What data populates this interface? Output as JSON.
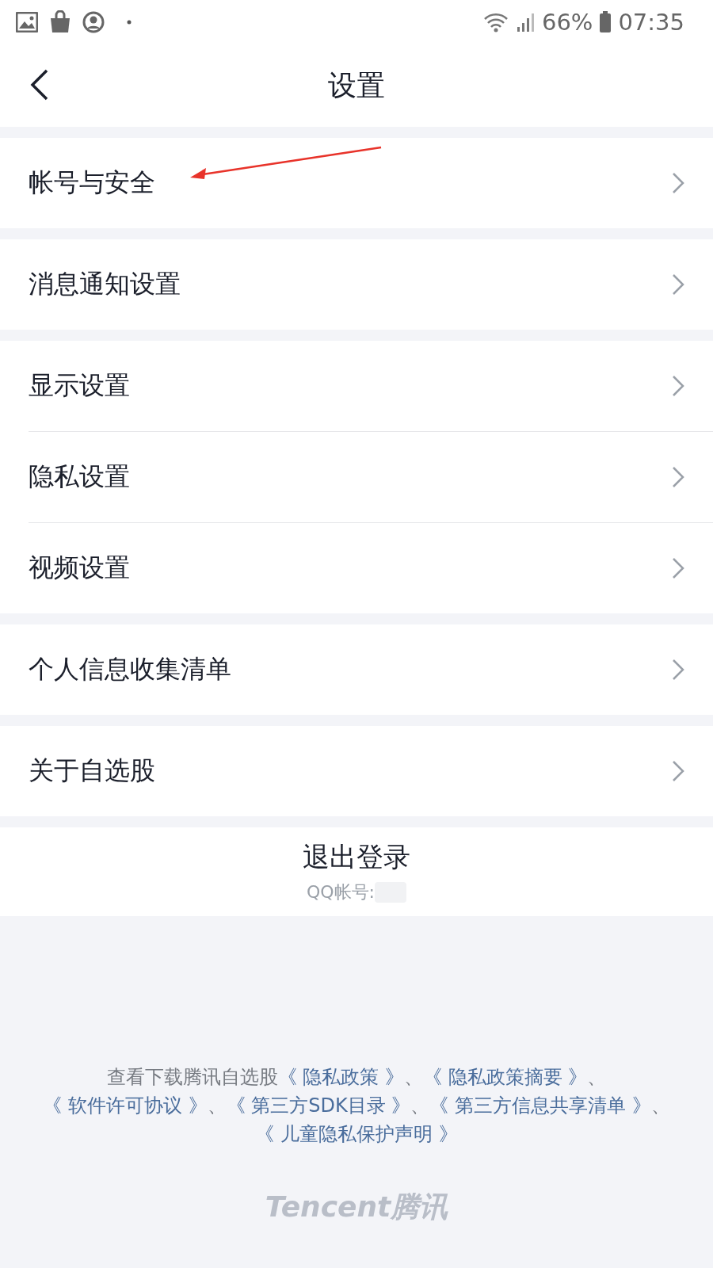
{
  "status_bar": {
    "battery": "66%",
    "time": "07:35"
  },
  "header": {
    "title": "设置"
  },
  "groups": [
    {
      "items": [
        {
          "label": "帐号与安全",
          "annotated": true
        }
      ]
    },
    {
      "items": [
        {
          "label": "消息通知设置",
          "annotated": false
        }
      ]
    },
    {
      "items": [
        {
          "label": "显示设置",
          "annotated": false
        },
        {
          "label": "隐私设置",
          "annotated": false
        },
        {
          "label": "视频设置",
          "annotated": false
        }
      ]
    },
    {
      "items": [
        {
          "label": "个人信息收集清单",
          "annotated": false
        }
      ]
    },
    {
      "items": [
        {
          "label": "关于自选股",
          "annotated": false
        }
      ]
    }
  ],
  "logout": {
    "label": "退出登录",
    "account_label": "QQ帐号:"
  },
  "legal": {
    "parts": [
      {
        "kind": "text",
        "text": "查看下载腾讯自选股"
      },
      {
        "kind": "link",
        "text": "《 隐私政策 》"
      },
      {
        "kind": "text",
        "text": "、"
      },
      {
        "kind": "link",
        "text": "《 隐私政策摘要 》"
      },
      {
        "kind": "text",
        "text": "、"
      },
      {
        "kind": "link",
        "text": "《 软件许可协议 》"
      },
      {
        "kind": "text",
        "text": "、"
      },
      {
        "kind": "link",
        "text": "《 第三方SDK目录 》"
      },
      {
        "kind": "text",
        "text": "、"
      },
      {
        "kind": "link",
        "text": "《 第三方信息共享清单 》"
      },
      {
        "kind": "text",
        "text": "、"
      },
      {
        "kind": "link",
        "text": "《 儿童隐私保护声明 》"
      }
    ]
  },
  "brand": {
    "latin": "Tencent",
    "cjk": "腾讯"
  }
}
